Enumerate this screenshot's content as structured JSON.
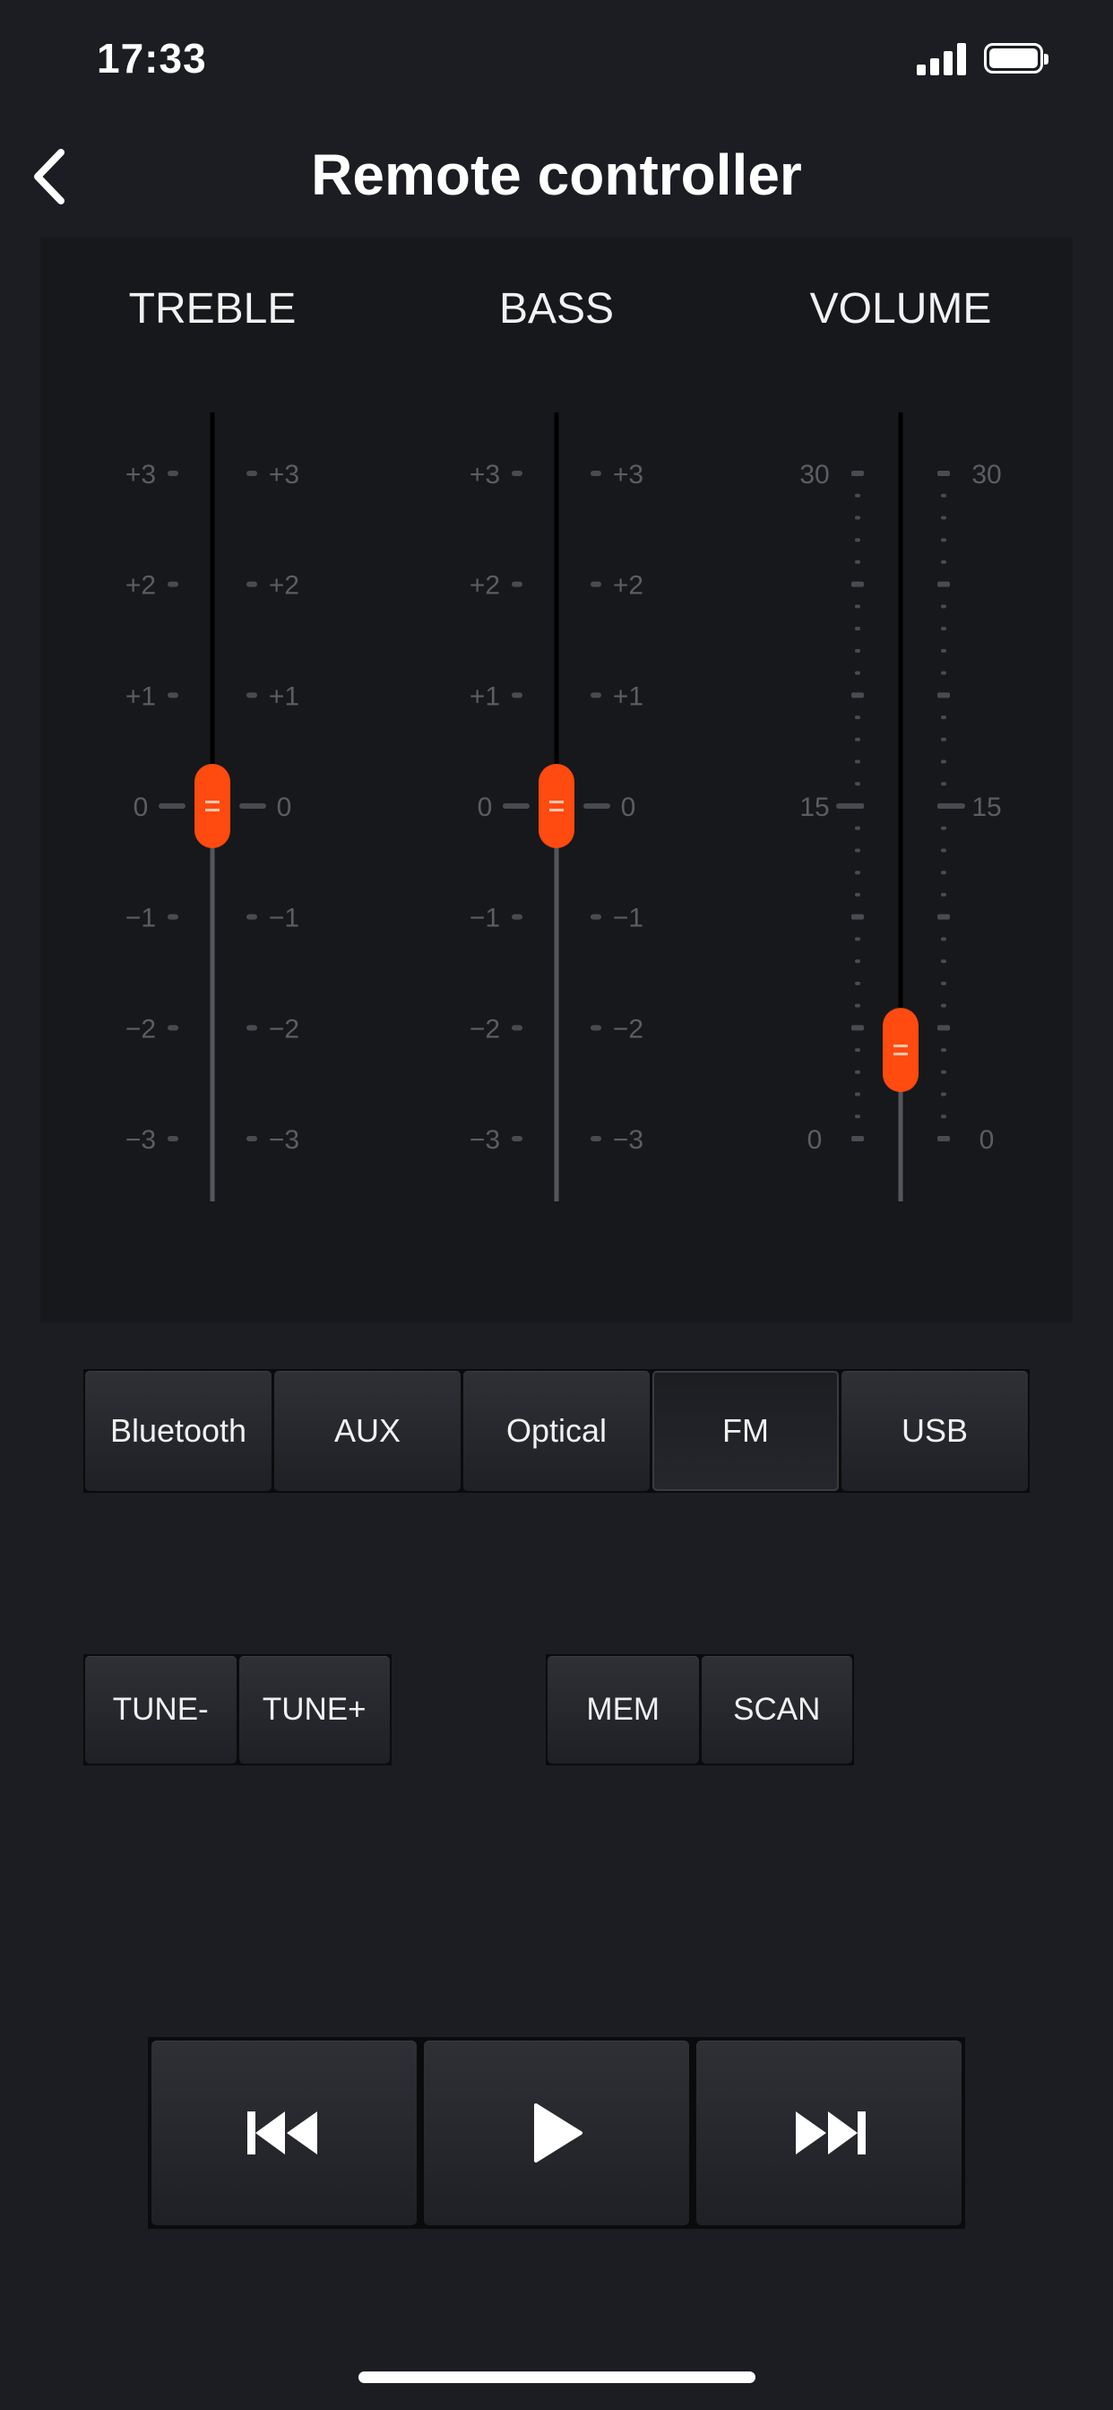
{
  "status": {
    "time": "17:33"
  },
  "nav": {
    "title": "Remote controller",
    "back_icon": "chevron-left-icon"
  },
  "equalizer": {
    "accent_color": "#ff4a10",
    "treble": {
      "label": "TREBLE",
      "ticks": [
        "+3",
        "+2",
        "+1",
        "0",
        "−1",
        "−2",
        "−3"
      ],
      "min": -3,
      "max": 3,
      "value": 0
    },
    "bass": {
      "label": "BASS",
      "ticks": [
        "+3",
        "+2",
        "+1",
        "0",
        "−1",
        "−2",
        "−3"
      ],
      "min": -3,
      "max": 3,
      "value": 0
    },
    "volume": {
      "label": "VOLUME",
      "ticks": [
        "30",
        "15",
        "0"
      ],
      "min": 0,
      "max": 30,
      "value": 4
    }
  },
  "sources": {
    "selected": "FM",
    "items": [
      "Bluetooth",
      "AUX",
      "Optical",
      "FM",
      "USB"
    ]
  },
  "tuner": {
    "tune_minus": "TUNE-",
    "tune_plus": "TUNE+",
    "mem": "MEM",
    "scan": "SCAN"
  },
  "transport": {
    "prev_icon": "skip-previous-icon",
    "play_icon": "play-icon",
    "next_icon": "skip-next-icon"
  }
}
